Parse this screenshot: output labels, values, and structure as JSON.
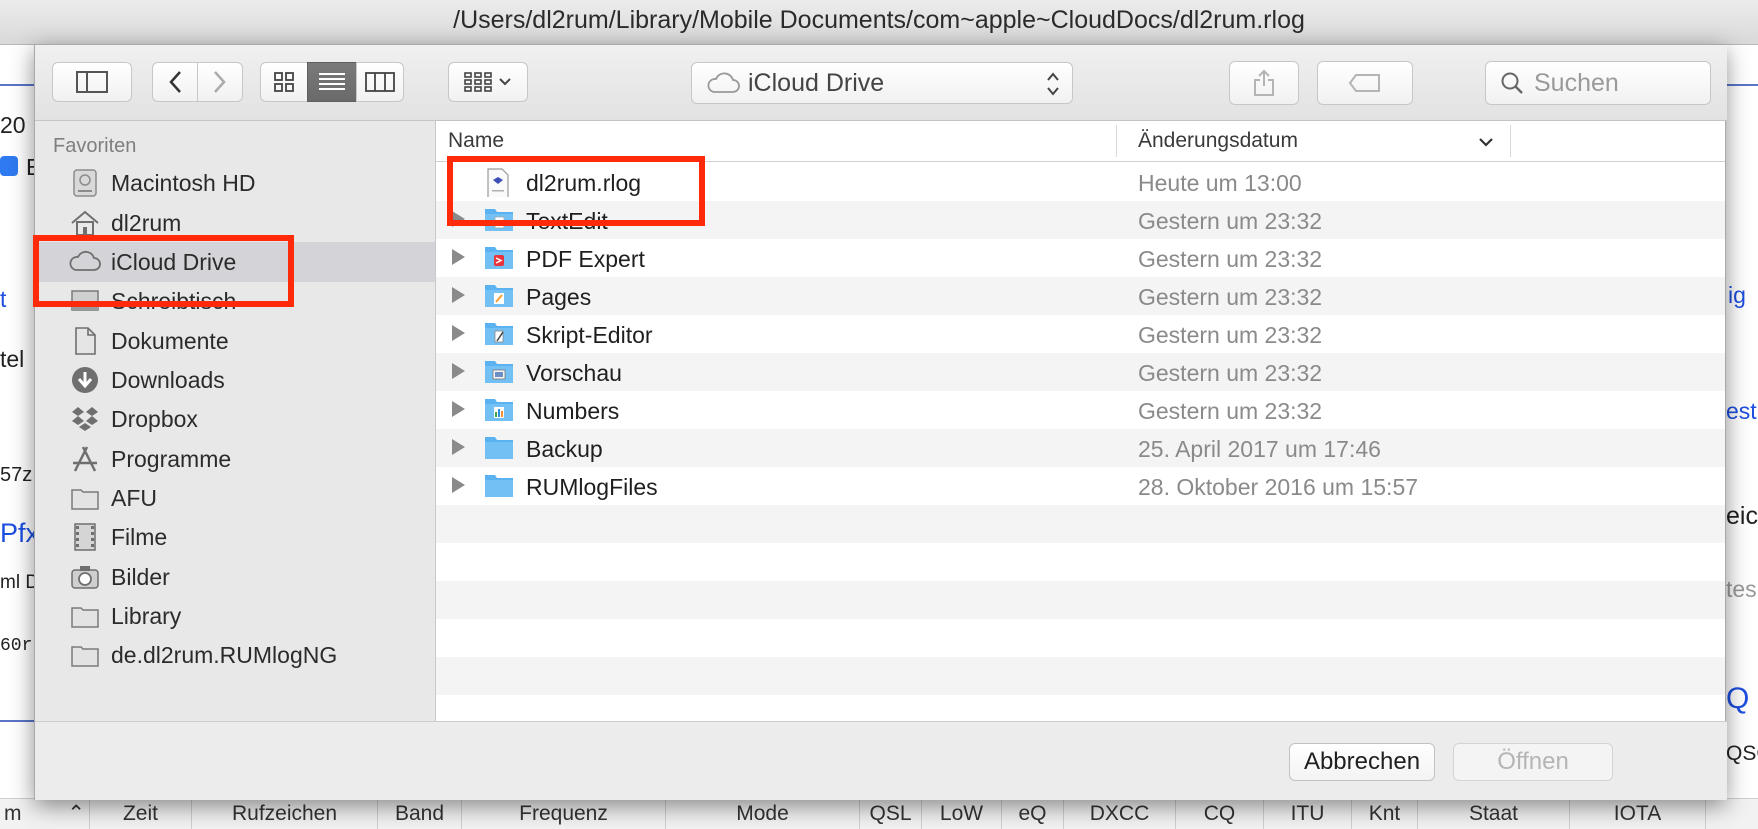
{
  "window_title": "/Users/dl2rum/Library/Mobile Documents/com~apple~CloudDocs/dl2rum.rlog",
  "background": {
    "left_fragments": [
      "20",
      "E",
      "t",
      "tel",
      "57z",
      "Pfx",
      "ml D",
      "60r",
      "m"
    ],
    "right_fragments": [
      "ig",
      "est",
      "eic",
      "tes",
      "Q",
      "QSC"
    ],
    "footer_columns": [
      "m",
      "Zeit",
      "Rufzeichen",
      "Band",
      "Frequenz",
      "Mode",
      "QSL",
      "LoW",
      "eQ",
      "DXCC",
      "CQ",
      "ITU",
      "Knt",
      "Staat",
      "IOTA"
    ]
  },
  "toolbar": {
    "sidebar_toggle_icon": "sidebar-icon",
    "back_icon": "chevron-left-icon",
    "forward_icon": "chevron-right-icon",
    "view_modes": [
      "icon-view",
      "list-view",
      "column-view"
    ],
    "active_view": "list-view",
    "arrange_icon": "grid-arrange-icon",
    "location": "iCloud Drive",
    "search_placeholder": "Suchen"
  },
  "sidebar": {
    "section_title": "Favoriten",
    "items": [
      {
        "label": "Macintosh HD",
        "icon": "harddisk-icon"
      },
      {
        "label": "dl2rum",
        "icon": "home-icon"
      },
      {
        "label": "iCloud Drive",
        "icon": "cloud-icon",
        "selected": true
      },
      {
        "label": "Schreibtisch",
        "icon": "desktop-icon"
      },
      {
        "label": "Dokumente",
        "icon": "documents-icon"
      },
      {
        "label": "Downloads",
        "icon": "downloads-icon"
      },
      {
        "label": "Dropbox",
        "icon": "dropbox-icon"
      },
      {
        "label": "Programme",
        "icon": "applications-icon"
      },
      {
        "label": "AFU",
        "icon": "folder-icon"
      },
      {
        "label": "Filme",
        "icon": "movies-icon"
      },
      {
        "label": "Bilder",
        "icon": "camera-icon"
      },
      {
        "label": "Library",
        "icon": "folder-icon"
      },
      {
        "label": "de.dl2rum.RUMlogNG",
        "icon": "folder-icon"
      }
    ]
  },
  "filelist": {
    "columns": {
      "name": "Name",
      "date": "Änderungsdatum"
    },
    "rows": [
      {
        "name": "dl2rum.rlog",
        "date": "Heute um 13:00",
        "kind": "document",
        "expandable": false
      },
      {
        "name": "TextEdit",
        "date": "Gestern um 23:32",
        "kind": "app-folder",
        "expandable": true
      },
      {
        "name": "PDF Expert",
        "date": "Gestern um 23:32",
        "kind": "app-folder",
        "expandable": true
      },
      {
        "name": "Pages",
        "date": "Gestern um 23:32",
        "kind": "app-folder",
        "expandable": true
      },
      {
        "name": "Skript-Editor",
        "date": "Gestern um 23:32",
        "kind": "app-folder",
        "expandable": true
      },
      {
        "name": "Vorschau",
        "date": "Gestern um 23:32",
        "kind": "app-folder",
        "expandable": true
      },
      {
        "name": "Numbers",
        "date": "Gestern um 23:32",
        "kind": "app-folder",
        "expandable": true
      },
      {
        "name": "Backup",
        "date": "25. April 2017 um 17:46",
        "kind": "folder",
        "expandable": true
      },
      {
        "name": "RUMlogFiles",
        "date": "28. Oktober 2016 um 15:57",
        "kind": "folder",
        "expandable": true
      }
    ]
  },
  "buttons": {
    "cancel": "Abbrechen",
    "open": "Öffnen"
  },
  "colors": {
    "highlight": "#ff2a0a",
    "folder": "#5ab2f0",
    "sidebar_selected": "#d3d3d8"
  }
}
